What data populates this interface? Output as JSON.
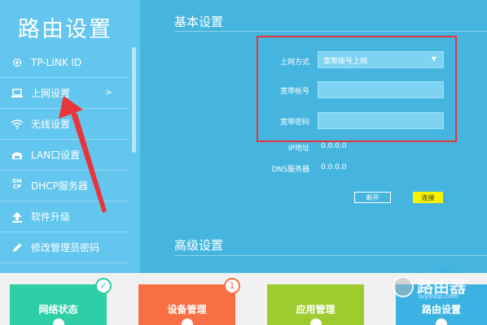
{
  "sidebar": {
    "title": "路由设置",
    "items": [
      {
        "label": "TP-LINK ID",
        "icon": "gear-icon"
      },
      {
        "label": "上网设置",
        "icon": "laptop-icon",
        "chevron": ">"
      },
      {
        "label": "无线设置",
        "icon": "wifi-icon"
      },
      {
        "label": "LAN口设置",
        "icon": "lan-icon"
      },
      {
        "label": "DHCP服务器",
        "icon": "dhcp-icon"
      },
      {
        "label": "软件升级",
        "icon": "upload-icon"
      },
      {
        "label": "修改管理员密码",
        "icon": "pencil-icon"
      }
    ]
  },
  "main": {
    "basic_title": "基本设置",
    "advanced_title": "高级设置",
    "form": {
      "mode_label": "上网方式",
      "mode_value": "宽带拨号上网",
      "account_label": "宽带帐号",
      "account_value": "",
      "password_label": "宽带密码",
      "password_value": "",
      "ip_label": "IP地址",
      "ip_value": "0.0.0.0",
      "dns_label": "DNS服务器",
      "dns_value": "0.0.0.0"
    },
    "buttons": {
      "disconnect": "断开",
      "connect": "连接"
    }
  },
  "tiles": [
    {
      "label": "网络状态",
      "badge": "✓",
      "color": "#2ecea6"
    },
    {
      "label": "设备管理",
      "badge": "1",
      "color": "#f86f45"
    },
    {
      "label": "应用管理",
      "color": "#9ecc2e"
    },
    {
      "label": "路由设置",
      "color": "#3cb2e2"
    }
  ],
  "watermark": {
    "text": "路由器",
    "domain": "luyouqi.com"
  },
  "colors": {
    "sidebar_bg": "#62c6ee",
    "main_bg": "#45b5df",
    "highlight": "#e8353a",
    "connect_btn": "#f6f200"
  }
}
